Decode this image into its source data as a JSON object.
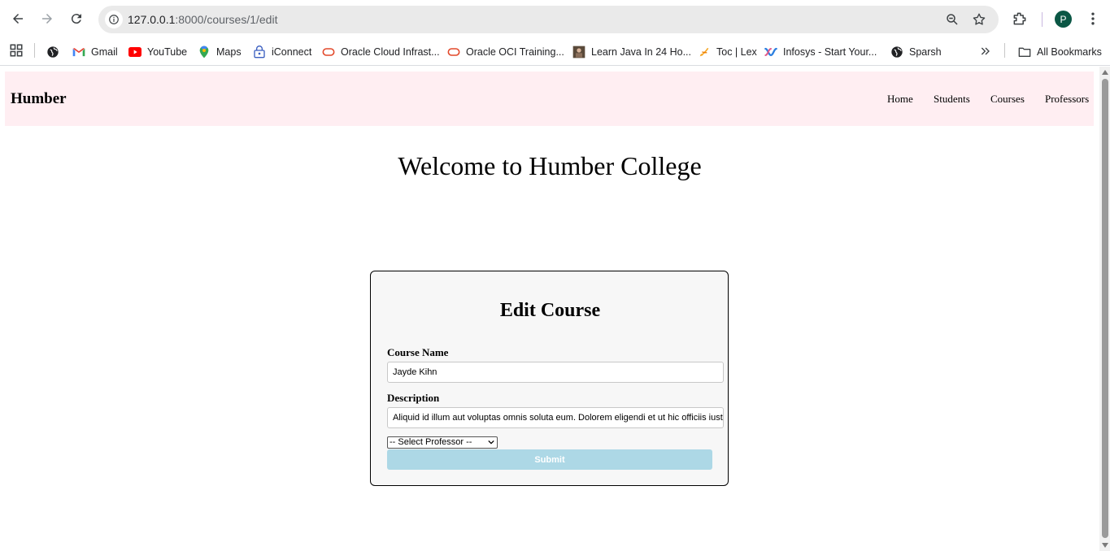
{
  "browser": {
    "url_host": "127.0.0.1",
    "url_path": ":8000/courses/1/edit",
    "avatar_letter": "P"
  },
  "bookmarks": {
    "items": [
      {
        "label": "Gmail",
        "icon": "gmail-icon"
      },
      {
        "label": "YouTube",
        "icon": "youtube-icon"
      },
      {
        "label": "Maps",
        "icon": "maps-icon"
      },
      {
        "label": "iConnect",
        "icon": "iconnect-icon"
      },
      {
        "label": "Oracle Cloud Infrast...",
        "icon": "oracle-icon"
      },
      {
        "label": "Oracle OCI Training...",
        "icon": "oracle-icon"
      },
      {
        "label": "Learn Java In 24 Ho...",
        "icon": "java-book-icon"
      },
      {
        "label": "Toc | Lex",
        "icon": "lex-icon"
      },
      {
        "label": "Infosys - Start Your...",
        "icon": "infosys-icon"
      },
      {
        "label": "Sparsh",
        "icon": "globe-icon"
      }
    ],
    "all_bookmarks_label": "All Bookmarks"
  },
  "site": {
    "brand": "Humber",
    "nav": [
      "Home",
      "Students",
      "Courses",
      "Professors"
    ],
    "welcome": "Welcome to Humber College"
  },
  "form": {
    "title": "Edit Course",
    "course_name_label": "Course Name",
    "course_name_value": "Jayde Kihn",
    "description_label": "Description",
    "description_value": "Aliquid id illum aut voluptas omnis soluta eum. Dolorem eligendi et ut hic officiis iusto",
    "professor_select_value": "-- Select Professor --",
    "submit_label": "Submit"
  },
  "colors": {
    "nav_background": "#ffeef2",
    "card_background": "#f7f7f7",
    "submit_background": "#add8e6"
  }
}
